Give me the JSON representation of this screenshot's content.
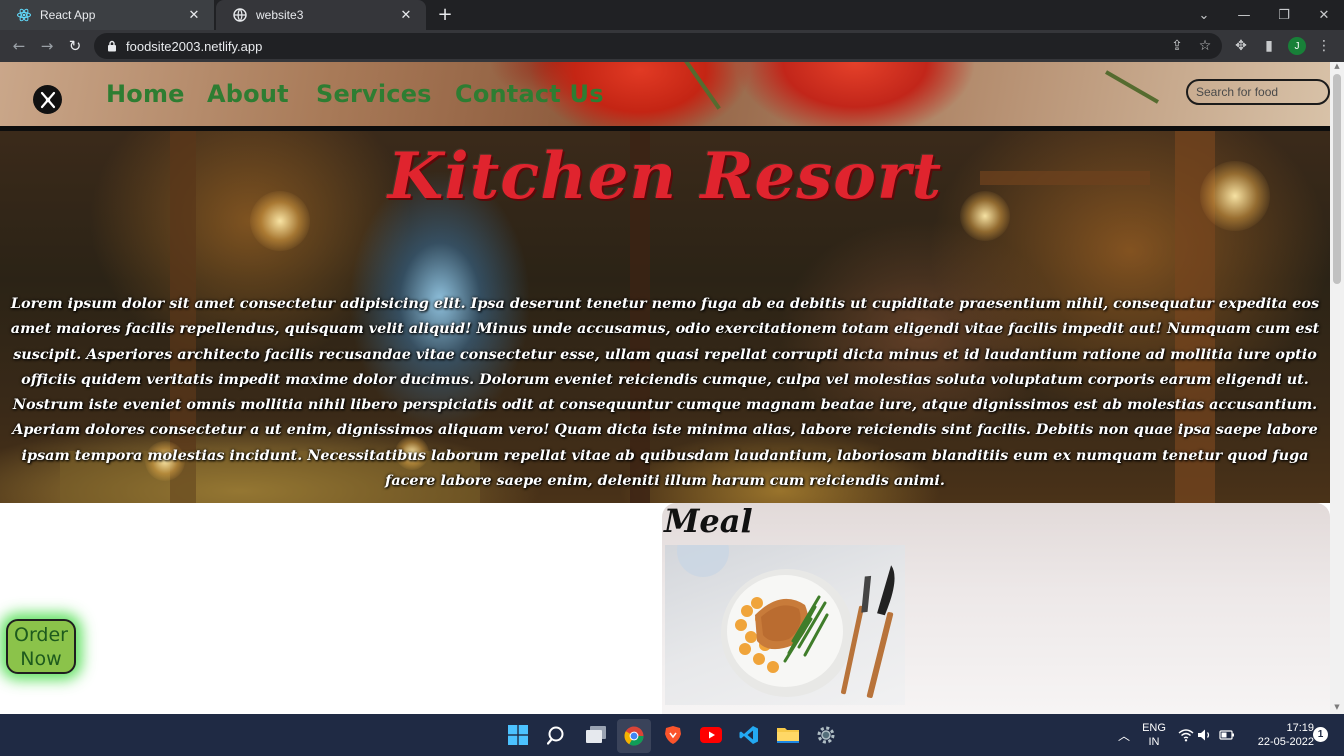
{
  "browser": {
    "tabs": [
      {
        "label": "React App",
        "icon": "react-icon",
        "active": false
      },
      {
        "label": "website3",
        "icon": "globe-icon",
        "active": true
      }
    ],
    "url": "foodsite2003.netlify.app",
    "profile_initial": "J"
  },
  "site": {
    "nav": {
      "links": [
        "Home",
        "About",
        "Services",
        "Contact Us"
      ],
      "search_placeholder": "Search for food"
    },
    "hero": {
      "title": "Kitchen Resort",
      "text": "Lorem ipsum dolor sit amet consectetur adipisicing elit. Ipsa deserunt tenetur nemo fuga ab ea debitis ut cupiditate praesentium nihil, consequatur expedita eos amet maiores facilis repellendus, quisquam velit aliquid! Minus unde accusamus, odio exercitationem totam eligendi vitae facilis impedit aut! Numquam cum est suscipit. Asperiores architecto facilis recusandae vitae consectetur esse, ullam quasi repellat corrupti dicta minus et id laudantium ratione ad mollitia iure optio officiis quidem veritatis impedit maxime dolor ducimus. Dolorum eveniet reiciendis cumque, culpa vel molestias soluta voluptatum corporis earum eligendi ut. Nostrum iste eveniet omnis mollitia nihil libero perspiciatis odit at consequuntur cumque magnam beatae iure, atque dignissimos est ab molestias accusantium. Aperiam dolores consectetur a ut enim, dignissimos aliquam vero! Quam dicta iste minima alias, labore reiciendis sint facilis. Debitis non quae ipsa saepe labore ipsam tempora molestias incidunt. Necessitatibus laborum repellat vitae ab quibusdam laudantium, laboriosam blanditiis eum ex numquam tenetur quod fuga facere labore saepe enim, deleniti illum harum cum reiciendis animi."
    },
    "meal": {
      "title": "Meal"
    },
    "order_button": "Order Now"
  },
  "taskbar": {
    "language_line1": "ENG",
    "language_line2": "IN",
    "time": "17:19",
    "date": "22-05-2022",
    "notification_count": "1"
  },
  "colors": {
    "nav_link": "#2e7d32",
    "hero_title": "#e0242e",
    "order_button": "#8bc34a",
    "taskbar": "#1f2a44"
  }
}
